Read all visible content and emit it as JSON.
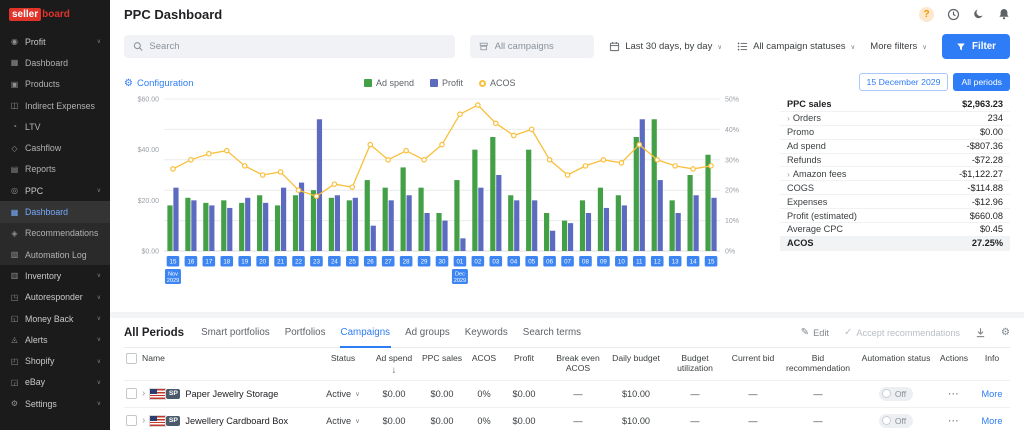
{
  "app": {
    "logo_seller": "seller",
    "logo_board": "board",
    "page_title": "PPC Dashboard"
  },
  "icons": {
    "help": "?",
    "gear": "⚙",
    "chevron_down": "∨",
    "chevron_right": "›",
    "sort_desc": "↓",
    "edit": "✎",
    "check": "✓",
    "ellipsis": "⋯"
  },
  "sidebar": {
    "items": [
      {
        "label": "Profit",
        "icon": "profit-icon",
        "chevron": true,
        "top": true
      },
      {
        "label": "Dashboard",
        "icon": "dashboard-icon",
        "sub": "profit"
      },
      {
        "label": "Products",
        "icon": "products-icon",
        "sub": "profit"
      },
      {
        "label": "Indirect Expenses",
        "icon": "indirect-expenses-icon",
        "sub": "profit"
      },
      {
        "label": "LTV",
        "icon": "ltv-icon",
        "sub": "profit"
      },
      {
        "label": "Cashflow",
        "icon": "cashflow-icon",
        "sub": "profit"
      },
      {
        "label": "Reports",
        "icon": "reports-icon",
        "sub": "profit"
      },
      {
        "label": "PPC",
        "icon": "ppc-icon",
        "chevron": true,
        "top": true
      },
      {
        "label": "Dashboard",
        "icon": "dashboard-icon",
        "sub": "ppc",
        "active": true
      },
      {
        "label": "Recommendations",
        "icon": "recommendations-icon",
        "sub": "ppc"
      },
      {
        "label": "Automation Log",
        "icon": "automation-log-icon",
        "sub": "ppc"
      },
      {
        "label": "Inventory",
        "icon": "inventory-icon",
        "chevron": true,
        "top": true
      },
      {
        "label": "Autoresponder",
        "icon": "autoresponder-icon",
        "chevron": true,
        "top": true
      },
      {
        "label": "Money Back",
        "icon": "money-back-icon",
        "chevron": true,
        "top": true
      },
      {
        "label": "Alerts",
        "icon": "alerts-icon",
        "chevron": true,
        "top": true
      },
      {
        "label": "Shopify",
        "icon": "shopify-icon",
        "chevron": true,
        "top": true
      },
      {
        "label": "eBay",
        "icon": "ebay-icon",
        "chevron": true,
        "top": true
      },
      {
        "label": "Settings",
        "icon": "settings-icon",
        "chevron": true,
        "top": true
      }
    ]
  },
  "filters": {
    "search_placeholder": "Search",
    "campaigns_placeholder": "All campaigns",
    "date_range": "Last 30 days, by day",
    "statuses": "All campaign statuses",
    "more_filters": "More filters",
    "filter_button": "Filter"
  },
  "chart_section": {
    "configuration": "Configuration",
    "legend": [
      {
        "label": "Ad spend",
        "color": "#43a047",
        "shape": "square"
      },
      {
        "label": "Profit",
        "color": "#5c6bc0",
        "shape": "square"
      },
      {
        "label": "ACOS",
        "color": "#f9bf3b",
        "shape": "circle"
      }
    ],
    "date_button": "15 December 2029",
    "all_periods_button": "All periods"
  },
  "chart_data": {
    "type": "bar",
    "categories": [
      "15",
      "16",
      "17",
      "18",
      "19",
      "20",
      "21",
      "22",
      "23",
      "24",
      "25",
      "26",
      "27",
      "28",
      "29",
      "30",
      "01",
      "02",
      "03",
      "04",
      "05",
      "06",
      "07",
      "08",
      "09",
      "10",
      "11",
      "12",
      "13",
      "14",
      "15"
    ],
    "month_markers": [
      {
        "index": 0,
        "label": "Nov 2029"
      },
      {
        "index": 16,
        "label": "Dec 2029"
      }
    ],
    "series": [
      {
        "name": "Ad spend",
        "type": "bar",
        "color": "#43a047",
        "axis": "left",
        "values": [
          18,
          21,
          19,
          20,
          19,
          22,
          18,
          22,
          24,
          21,
          20,
          28,
          25,
          33,
          25,
          15,
          28,
          40,
          45,
          22,
          40,
          15,
          12,
          20,
          25,
          22,
          45,
          52,
          20,
          30,
          38
        ]
      },
      {
        "name": "Profit",
        "type": "bar",
        "color": "#5c6bc0",
        "axis": "left",
        "values": [
          25,
          20,
          18,
          17,
          21,
          19,
          25,
          27,
          52,
          22,
          21,
          10,
          20,
          22,
          15,
          12,
          5,
          25,
          30,
          20,
          20,
          8,
          11,
          15,
          17,
          18,
          52,
          28,
          15,
          22,
          21
        ]
      },
      {
        "name": "ACOS",
        "type": "line",
        "color": "#f9bf3b",
        "axis": "right",
        "values": [
          27,
          30,
          32,
          33,
          28,
          25,
          26,
          20,
          18,
          22,
          21,
          35,
          30,
          33,
          30,
          35,
          45,
          48,
          42,
          38,
          40,
          30,
          25,
          28,
          30,
          29,
          35,
          30,
          28,
          27,
          28
        ]
      }
    ],
    "left_axis": {
      "min": 0,
      "max": 60,
      "ticks": [
        "$0.00",
        "$20.00",
        "$40.00",
        "$60.00"
      ]
    },
    "right_axis": {
      "min": 0,
      "max": 50,
      "ticks": [
        "0%",
        "10%",
        "20%",
        "30%",
        "40%",
        "50%"
      ]
    },
    "grid": true,
    "legend_position": "top-center"
  },
  "stats": {
    "rows": [
      {
        "label": "PPC sales",
        "value": "$2,963.23",
        "bold": true
      },
      {
        "label": "Orders",
        "value": "234",
        "expandable": true
      },
      {
        "label": "Promo",
        "value": "$0.00"
      },
      {
        "label": "Ad spend",
        "value": "-$807.36"
      },
      {
        "label": "Refunds",
        "value": "-$72.28"
      },
      {
        "label": "Amazon fees",
        "value": "-$1,122.27",
        "expandable": true
      },
      {
        "label": "COGS",
        "value": "-$114.88"
      },
      {
        "label": "Expenses",
        "value": "-$12.96"
      },
      {
        "label": "Profit (estimated)",
        "value": "$660.08"
      },
      {
        "label": "Average CPC",
        "value": "$0.45"
      },
      {
        "label": "ACOS",
        "value": "27.25%",
        "bold": true,
        "highlight": true
      }
    ]
  },
  "bottom": {
    "period_label": "All Periods",
    "tabs": [
      {
        "label": "Smart portfolios"
      },
      {
        "label": "Portfolios"
      },
      {
        "label": "Campaigns",
        "active": true
      },
      {
        "label": "Ad groups"
      },
      {
        "label": "Keywords"
      },
      {
        "label": "Search terms"
      }
    ],
    "actions": {
      "edit": "Edit",
      "accept": "Accept recommendations"
    },
    "table": {
      "columns": [
        {
          "label": "Name",
          "key": "name"
        },
        {
          "label": "Status",
          "key": "status"
        },
        {
          "label": "Ad spend",
          "key": "ad_spend",
          "sort": "desc"
        },
        {
          "label": "PPC sales",
          "key": "ppc_sales"
        },
        {
          "label": "ACOS",
          "key": "acos"
        },
        {
          "label": "Profit",
          "key": "profit"
        },
        {
          "label": "Break even ACOS",
          "key": "break_even_acos"
        },
        {
          "label": "Daily budget",
          "key": "daily_budget"
        },
        {
          "label": "Budget utilization",
          "key": "budget_utilization"
        },
        {
          "label": "Current bid",
          "key": "current_bid"
        },
        {
          "label": "Bid recommendation",
          "key": "bid_recommendation"
        },
        {
          "label": "Automation status",
          "key": "automation_status"
        },
        {
          "label": "Actions",
          "key": "actions"
        },
        {
          "label": "Info",
          "key": "info"
        }
      ],
      "rows": [
        {
          "name": "Paper Jewelry Storage",
          "badge": "SP",
          "status": "Active",
          "ad_spend": "$0.00",
          "ppc_sales": "$0.00",
          "acos": "0%",
          "profit": "$0.00",
          "break_even_acos": "—",
          "daily_budget": "$10.00",
          "budget_utilization": "—",
          "current_bid": "—",
          "bid_recommendation": "—",
          "automation_status": "Off",
          "info": "More"
        },
        {
          "name": "Jewellery Cardboard Box",
          "badge": "SP",
          "status": "Active",
          "ad_spend": "$0.00",
          "ppc_sales": "$0.00",
          "acos": "0%",
          "profit": "$0.00",
          "break_even_acos": "—",
          "daily_budget": "$10.00",
          "budget_utilization": "—",
          "current_bid": "—",
          "bid_recommendation": "—",
          "automation_status": "Off",
          "info": "More"
        }
      ]
    }
  }
}
